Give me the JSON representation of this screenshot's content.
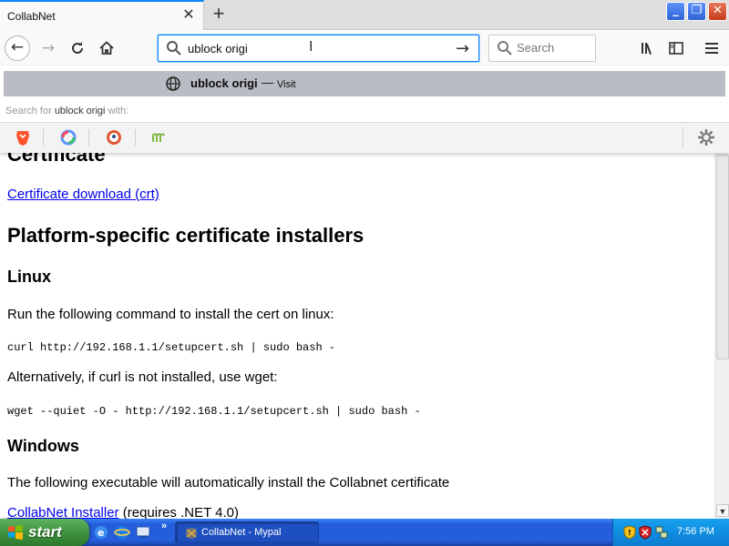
{
  "browser": {
    "tab_title": "CollabNet",
    "url_value": "ublock origi",
    "search_placeholder": "Search"
  },
  "urlbar_popup": {
    "result_text": "ublock origi",
    "result_separator": "—",
    "result_action": "Visit",
    "search_for_prefix": "Search for",
    "search_for_term": "ublock origi",
    "search_for_suffix": "with:",
    "engines": [
      "brave-icon",
      "qwant-icon",
      "duckduckgo-icon",
      "mojeek-icon"
    ]
  },
  "page": {
    "heading_cert": "Certificate",
    "cert_link": "Certificate download (crt)",
    "heading_platform": "Platform-specific certificate installers",
    "heading_linux": "Linux",
    "linux_text": "Run the following command to install the cert on linux:",
    "linux_cmd": "curl http://192.168.1.1/setupcert.sh | sudo bash -",
    "alt_text": "Alternatively, if curl is not installed, use wget:",
    "wget_cmd": "wget --quiet -O - http://192.168.1.1/setupcert.sh | sudo bash -",
    "heading_windows": "Windows",
    "windows_text": "The following executable will automatically install the Collabnet certificate",
    "installer_link": "CollabNet Installer",
    "installer_note": " (requires .NET 4.0)"
  },
  "taskbar": {
    "start_label": "start",
    "task_label": "CollabNet - Mypal",
    "clock": "7:56 PM",
    "more": "»"
  },
  "colors": {
    "accent": "#0a84ff",
    "link": "#0000ee",
    "taskbar": "#245edb",
    "start": "#3a8d3a"
  }
}
